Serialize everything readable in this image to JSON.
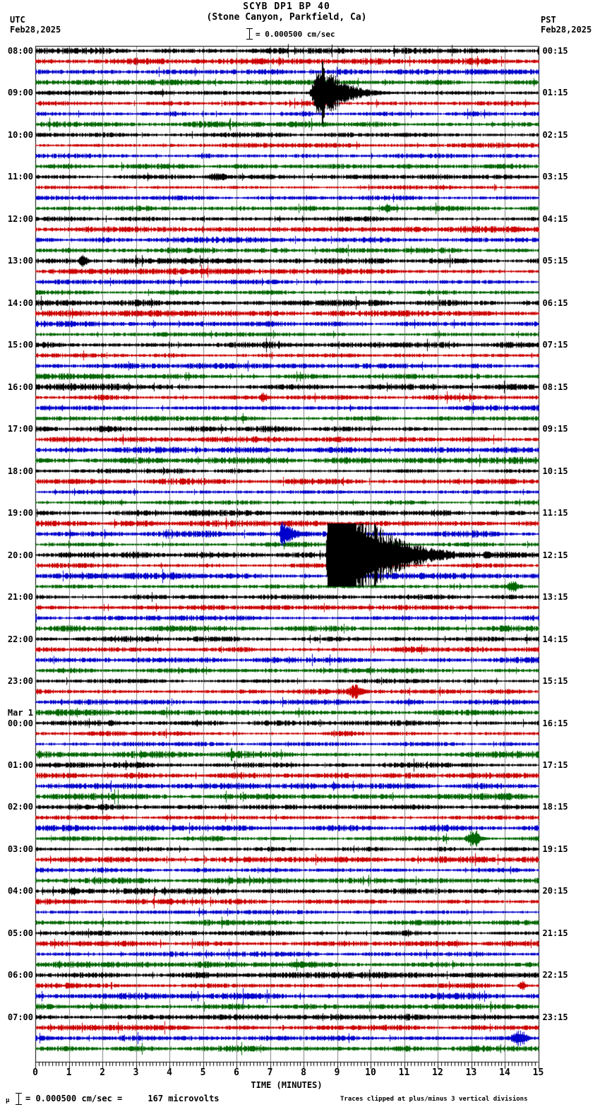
{
  "header": {
    "title": "SCYB DP1 BP 40",
    "subtitle": "(Stone Canyon, Parkfield, Ca)",
    "left_timezone": "UTC",
    "left_date": "Feb28,2025",
    "right_timezone": "PST",
    "right_date": "Feb28,2025",
    "scale_label": "= 0.000500 cm/sec"
  },
  "axis": {
    "xlabel": "TIME (MINUTES)",
    "tick_labels": [
      "0",
      "1",
      "2",
      "3",
      "4",
      "5",
      "6",
      "7",
      "8",
      "9",
      "10",
      "11",
      "12",
      "13",
      "14",
      "15"
    ]
  },
  "footer": {
    "mu_glyph": "μ",
    "left_text": "= 0.000500 cm/sec =     167 microvolts",
    "right_text": "Traces clipped at plus/minus 3 vertical divisions"
  },
  "chart_data": {
    "type": "line",
    "kind": "helicorder-seismogram",
    "title": "SCYB DP1 BP 40 (Stone Canyon, Parkfield, Ca)",
    "minutes_per_line": 15,
    "rows": 96,
    "start_time_utc": "Feb28,2025 08:00 UTC",
    "end_time_utc": "Mar 1,2025 07:45 UTC",
    "clip_divisions": 3,
    "x_range_minutes": [
      0,
      15
    ],
    "grid": true,
    "colors_cycle": [
      "#000000",
      "#cc0000",
      "#0000cc",
      "#006600"
    ],
    "grid_color": "#808080",
    "noise_amp_divisions": 0.15,
    "left_labels": [
      {
        "row": 0,
        "text": "08:00"
      },
      {
        "row": 4,
        "text": "09:00"
      },
      {
        "row": 8,
        "text": "10:00"
      },
      {
        "row": 12,
        "text": "11:00"
      },
      {
        "row": 16,
        "text": "12:00"
      },
      {
        "row": 20,
        "text": "13:00"
      },
      {
        "row": 24,
        "text": "14:00"
      },
      {
        "row": 28,
        "text": "15:00"
      },
      {
        "row": 32,
        "text": "16:00"
      },
      {
        "row": 36,
        "text": "17:00"
      },
      {
        "row": 40,
        "text": "18:00"
      },
      {
        "row": 44,
        "text": "19:00"
      },
      {
        "row": 48,
        "text": "20:00"
      },
      {
        "row": 52,
        "text": "21:00"
      },
      {
        "row": 56,
        "text": "22:00"
      },
      {
        "row": 60,
        "text": "23:00"
      },
      {
        "row": 64,
        "text": "00:00"
      },
      {
        "row": 68,
        "text": "01:00"
      },
      {
        "row": 72,
        "text": "02:00"
      },
      {
        "row": 76,
        "text": "03:00"
      },
      {
        "row": 80,
        "text": "04:00"
      },
      {
        "row": 84,
        "text": "05:00"
      },
      {
        "row": 88,
        "text": "06:00"
      },
      {
        "row": 92,
        "text": "07:00"
      }
    ],
    "date_label": {
      "row": 64,
      "text": "Mar 1"
    },
    "right_labels": [
      {
        "row": 0,
        "text": "00:15"
      },
      {
        "row": 4,
        "text": "01:15"
      },
      {
        "row": 8,
        "text": "02:15"
      },
      {
        "row": 12,
        "text": "03:15"
      },
      {
        "row": 16,
        "text": "04:15"
      },
      {
        "row": 20,
        "text": "05:15"
      },
      {
        "row": 24,
        "text": "06:15"
      },
      {
        "row": 28,
        "text": "07:15"
      },
      {
        "row": 32,
        "text": "08:15"
      },
      {
        "row": 36,
        "text": "09:15"
      },
      {
        "row": 40,
        "text": "10:15"
      },
      {
        "row": 44,
        "text": "11:15"
      },
      {
        "row": 48,
        "text": "12:15"
      },
      {
        "row": 52,
        "text": "13:15"
      },
      {
        "row": 56,
        "text": "14:15"
      },
      {
        "row": 60,
        "text": "15:15"
      },
      {
        "row": 64,
        "text": "16:15"
      },
      {
        "row": 68,
        "text": "17:15"
      },
      {
        "row": 72,
        "text": "18:15"
      },
      {
        "row": 76,
        "text": "19:15"
      },
      {
        "row": 80,
        "text": "20:15"
      },
      {
        "row": 84,
        "text": "21:15"
      },
      {
        "row": 88,
        "text": "22:15"
      },
      {
        "row": 92,
        "text": "23:15"
      }
    ],
    "events": [
      {
        "row": 4,
        "utc_row": "09:00",
        "start": 8.15,
        "peak": 8.35,
        "hold": 0.5,
        "end": 10.8,
        "amp": 1.55,
        "note": "earthquake body + coda"
      },
      {
        "row": 4,
        "utc_row": "09:00",
        "start": 8.48,
        "peak": 8.56,
        "hold": 0.04,
        "end": 8.78,
        "amp": 4.2,
        "clip": true,
        "note": "clipped spike"
      },
      {
        "row": 12,
        "utc_row": "11:00",
        "start": 4.9,
        "peak": 5.3,
        "hold": 0.3,
        "end": 6.1,
        "amp": 0.3
      },
      {
        "row": 15,
        "utc_row": "11:45",
        "start": 10.15,
        "peak": 10.45,
        "hold": 0.1,
        "end": 10.95,
        "amp": 0.3
      },
      {
        "row": 20,
        "utc_row": "13:00",
        "start": 1.22,
        "peak": 1.38,
        "hold": 0.08,
        "end": 1.8,
        "amp": 0.5
      },
      {
        "row": 33,
        "utc_row": "16:15",
        "start": 6.6,
        "peak": 6.78,
        "hold": 0.05,
        "end": 7.2,
        "amp": 0.45
      },
      {
        "row": 39,
        "utc_row": "17:45",
        "start": 3.55,
        "peak": 3.7,
        "hold": 0.05,
        "end": 4.0,
        "amp": 0.28
      },
      {
        "row": 46,
        "utc_row": "19:30",
        "start": 7.25,
        "peak": 7.33,
        "hold": 0.1,
        "end": 8.5,
        "amp": 0.95
      },
      {
        "row": 48,
        "utc_row": "20:00",
        "start": 8.66,
        "peak": 8.72,
        "hold": 0.42,
        "end": 12.5,
        "amp": 6.0,
        "clip": true,
        "note": "large local earthquake, clipped at 3 divisions"
      },
      {
        "row": 48,
        "utc_row": "20:00",
        "start": 13.3,
        "peak": 13.45,
        "hold": 0.05,
        "end": 13.8,
        "amp": 0.4
      },
      {
        "row": 51,
        "utc_row": "20:45",
        "start": 13.95,
        "peak": 14.2,
        "hold": 0.1,
        "end": 14.6,
        "amp": 0.5
      },
      {
        "row": 61,
        "utc_row": "23:15",
        "start": 9.2,
        "peak": 9.45,
        "hold": 0.15,
        "end": 10.2,
        "amp": 0.55
      },
      {
        "row": 75,
        "utc_row": "02:45",
        "start": 12.75,
        "peak": 13.0,
        "hold": 0.15,
        "end": 13.65,
        "amp": 0.65
      },
      {
        "row": 80,
        "utc_row": "04:00",
        "start": 1.0,
        "peak": 1.1,
        "hold": 0.05,
        "end": 1.4,
        "amp": 0.45
      },
      {
        "row": 89,
        "utc_row": "06:15",
        "start": 14.35,
        "peak": 14.5,
        "hold": 0.05,
        "end": 14.85,
        "amp": 0.4
      },
      {
        "row": 94,
        "utc_row": "07:30",
        "start": 14.05,
        "peak": 14.4,
        "hold": 0.15,
        "end": 14.95,
        "amp": 0.6
      }
    ]
  }
}
